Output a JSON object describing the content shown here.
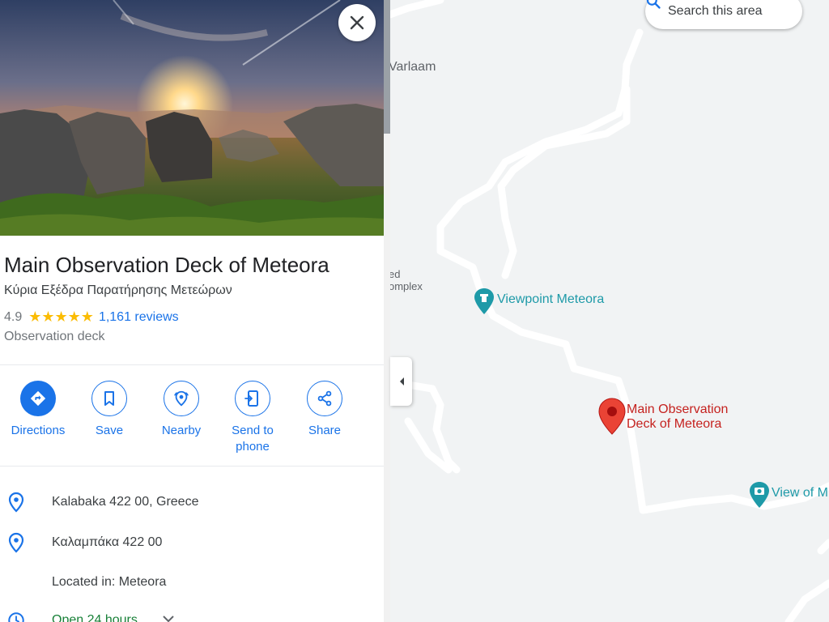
{
  "place": {
    "title": "Main Observation Deck of Meteora",
    "subtitle": "Κύρια Εξέδρα Παρατήρησης Μετεώρων",
    "rating": "4.9",
    "stars": "★★★★★",
    "reviews": "1,161 reviews",
    "category": "Observation deck"
  },
  "actions": [
    {
      "label": "Directions",
      "icon": "directions-icon"
    },
    {
      "label": "Save",
      "icon": "bookmark-icon"
    },
    {
      "label": "Nearby",
      "icon": "nearby-icon"
    },
    {
      "label": "Send to\nphone",
      "line1": "Send to",
      "line2": "phone",
      "icon": "send-to-phone-icon"
    },
    {
      "label": "Share",
      "icon": "share-icon"
    }
  ],
  "info": {
    "address": "Kalabaka 422 00, Greece",
    "address_local": "Καλαμπάκα 422 00",
    "located_in": "Located in: Meteora",
    "hours": "Open 24 hours"
  },
  "map": {
    "search_area": "Search this area",
    "labels": {
      "varlaam": "Varlaam",
      "ed": "ed",
      "omplex": "omplex",
      "viewpoint": "Viewpoint Meteora",
      "pin_line1": "Main Observation",
      "pin_line2": "Deck of Meteora",
      "view_of": "View of M"
    }
  },
  "colors": {
    "accent": "#1a73e8",
    "star": "#fbbc04",
    "poi_teal": "#1e9aa8",
    "pin_red": "#ea4335",
    "hours_green": "#188038"
  }
}
